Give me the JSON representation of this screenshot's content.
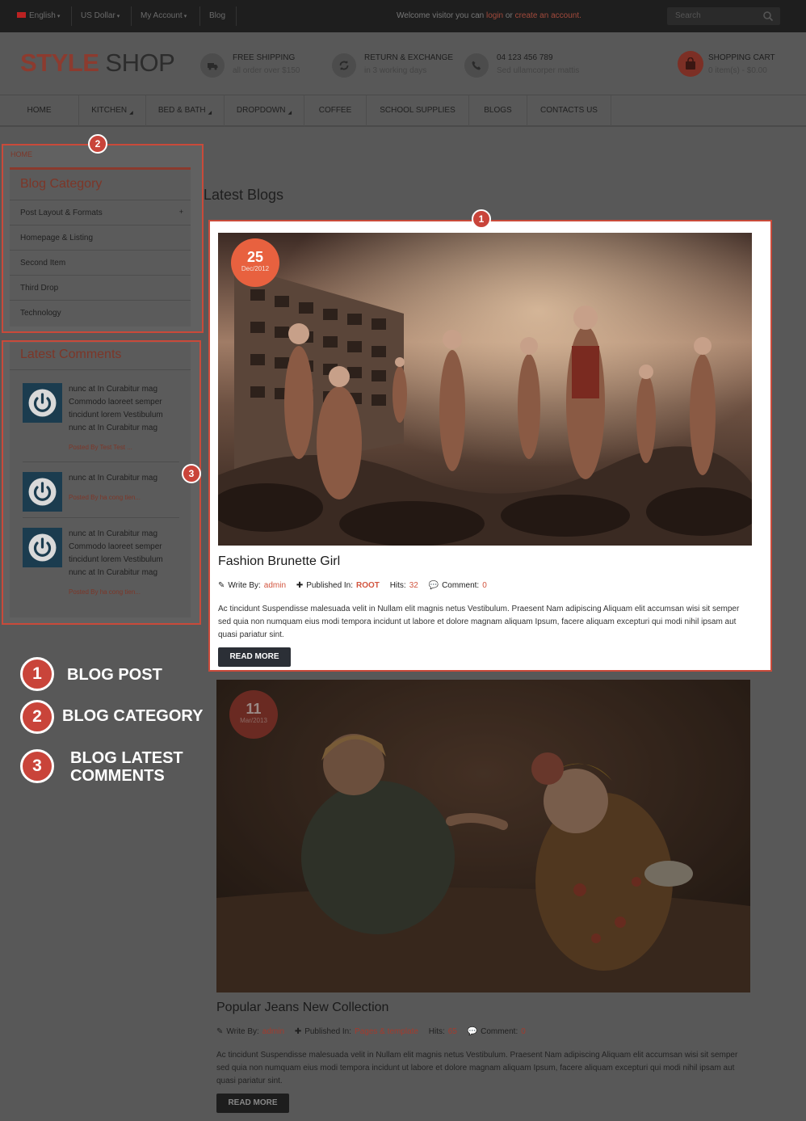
{
  "topbar": {
    "language": "English",
    "currency": "US Dollar",
    "account": "My Account",
    "blog": "Blog",
    "welcome_prefix": "Welcome visitor you can",
    "login": "login",
    "or": "or",
    "create_account": "create an account.",
    "search_placeholder": "Search"
  },
  "header": {
    "logo_part1": "STYLE",
    "logo_part2": "SHOP",
    "features": [
      {
        "title": "FREE SHIPPING",
        "sub": "all order over $150",
        "icon": "truck-icon"
      },
      {
        "title": "RETURN & EXCHANGE",
        "sub": "in 3 working days",
        "icon": "refresh-icon"
      },
      {
        "title": "04 123 456 789",
        "sub": "Sed ullamcorper mattis",
        "icon": "phone-icon"
      }
    ],
    "cart": {
      "title": "SHOPPING CART",
      "summary": "0 item(s) - $0.00",
      "icon": "shopping-bag-icon"
    }
  },
  "nav": {
    "items": [
      "HOME",
      "KITCHEN",
      "BED & BATH",
      "DROPDOWN",
      "COFFEE",
      "SCHOOL SUPPLIES",
      "BLOGS",
      "CONTACTS US"
    ]
  },
  "sidebar": {
    "breadcrumb": "HOME",
    "category_title": "Blog Category",
    "categories": [
      "Post Layout & Formats",
      "Homepage & Listing",
      "Second Item",
      "Third Drop",
      "Technology"
    ],
    "expand_symbol": "+",
    "comments_title": "Latest Comments",
    "comments": [
      {
        "text": "nunc at In Curabitur mag Commodo laoreet semper tincidunt lorem Vestibulum nunc at In Curabitur mag",
        "by": "Posted By Test Test ..."
      },
      {
        "text": "nunc at In Curabitur mag",
        "by": "Posted By ha cong tien..."
      },
      {
        "text": "nunc at In Curabitur mag Commodo laoreet semper tincidunt lorem Vestibulum nunc at In Curabitur mag",
        "by": "Posted By ha cong tien..."
      }
    ]
  },
  "main": {
    "title": "Latest Blogs",
    "write_by": "Write By:",
    "published_in": "Published In:",
    "hits_label": "Hits:",
    "comment_label": "Comment:",
    "read_more": "READ MORE",
    "posts": [
      {
        "day": "25",
        "month": "Dec/2012",
        "title": "Fashion Brunette Girl",
        "author": "admin",
        "category": "ROOT",
        "hits": "32",
        "comments": "0",
        "excerpt": "Ac tincidunt Suspendisse malesuada velit in Nullam elit magnis netus Vestibulum. Praesent Nam adipiscing Aliquam elit accumsan wisi sit semper sed quia non numquam eius modi tempora incidunt ut labore et dolore magnam aliquam Ipsum, facere aliquam excepturi qui modi nihil ipsam aut quasi pariatur sint."
      },
      {
        "day": "11",
        "month": "Mar/2013",
        "title": "Popular Jeans New Collection",
        "author": "admin",
        "category": "Pages & template",
        "hits": "65",
        "comments": "0",
        "excerpt": "Ac tincidunt Suspendisse malesuada velit in Nullam elit magnis netus Vestibulum. Praesent Nam adipiscing Aliquam elit accumsan wisi sit semper sed quia non numquam eius modi tempora incidunt ut labore et dolore magnam aliquam Ipsum, facere aliquam excepturi qui modi nihil ipsam aut quasi pariatur sint."
      }
    ]
  },
  "annotations": {
    "callouts": [
      "1",
      "2",
      "3"
    ],
    "legend": [
      {
        "num": "1",
        "label": "BLOG POST"
      },
      {
        "num": "2",
        "label": "BLOG CATEGORY"
      },
      {
        "num": "3",
        "label": "BLOG LATEST COMMENTS"
      }
    ]
  },
  "colors": {
    "accent": "#c9443a",
    "brand": "#8c3b2f",
    "highlight_border": "#c94a3a"
  }
}
